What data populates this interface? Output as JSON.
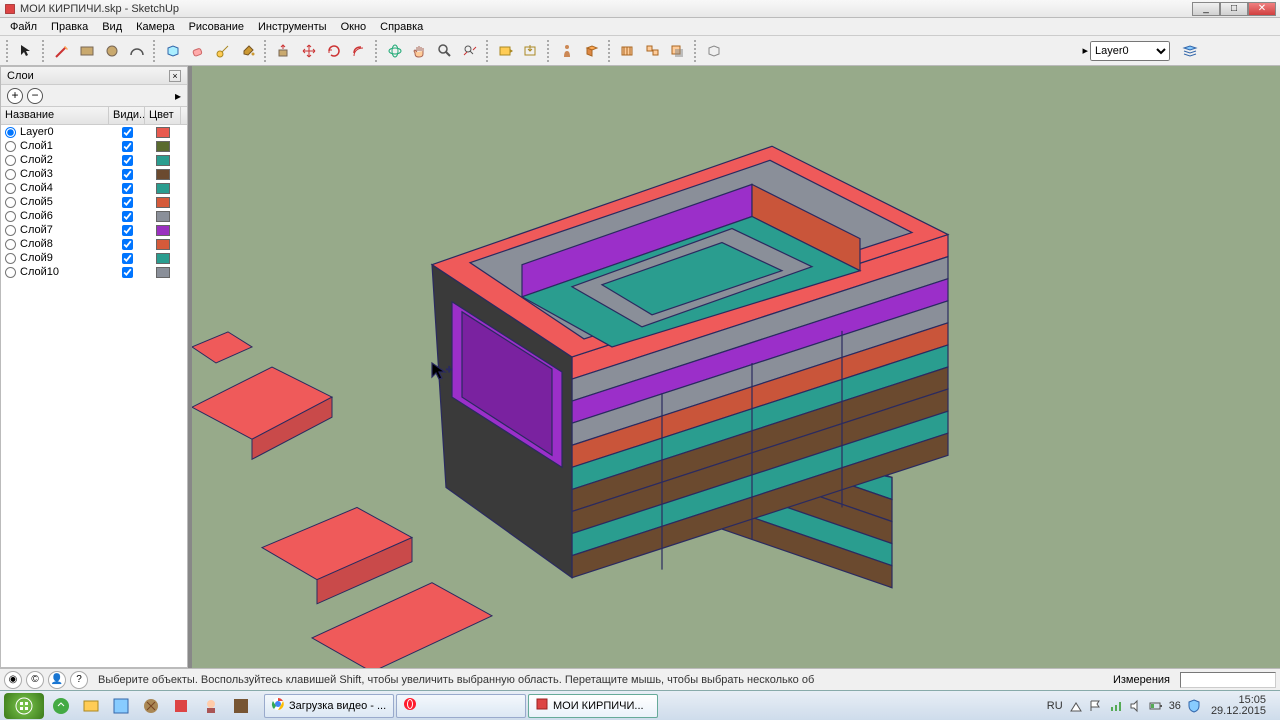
{
  "window": {
    "title": "МОИ КИРПИЧИ.skp - SketchUp"
  },
  "menu": [
    "Файл",
    "Правка",
    "Вид",
    "Камера",
    "Рисование",
    "Инструменты",
    "Окно",
    "Справка"
  ],
  "layer_dropdown": {
    "selected": "Layer0"
  },
  "layers_panel": {
    "title": "Слои",
    "col_name": "Название",
    "col_visible": "Види...",
    "col_color": "Цвет",
    "layers": [
      {
        "name": "Layer0",
        "active": true,
        "visible": true,
        "color": "#e85a4f"
      },
      {
        "name": "Слой1",
        "active": false,
        "visible": true,
        "color": "#5a6b2f"
      },
      {
        "name": "Слой2",
        "active": false,
        "visible": true,
        "color": "#2a9d8f"
      },
      {
        "name": "Слой3",
        "active": false,
        "visible": true,
        "color": "#6b4a2f"
      },
      {
        "name": "Слой4",
        "active": false,
        "visible": true,
        "color": "#2a9d8f"
      },
      {
        "name": "Слой5",
        "active": false,
        "visible": true,
        "color": "#d55a3a"
      },
      {
        "name": "Слой6",
        "active": false,
        "visible": true,
        "color": "#8a8f99"
      },
      {
        "name": "Слой7",
        "active": false,
        "visible": true,
        "color": "#9b30c0"
      },
      {
        "name": "Слой8",
        "active": false,
        "visible": true,
        "color": "#d55a3a"
      },
      {
        "name": "Слой9",
        "active": false,
        "visible": true,
        "color": "#2a9d8f"
      },
      {
        "name": "Слой10",
        "active": false,
        "visible": true,
        "color": "#8a8f99"
      }
    ]
  },
  "status": {
    "hint": "Выберите объекты. Воспользуйтесь клавишей Shift, чтобы увеличить выбранную область. Перетащите мышь, чтобы выбрать несколько об",
    "measurements_label": "Измерения"
  },
  "taskbar": {
    "tasks": [
      {
        "label": "Загрузка видео - ...",
        "icon": "chrome"
      },
      {
        "label": "",
        "icon": "opera"
      },
      {
        "label": "МОИ КИРПИЧИ...",
        "icon": "sketchup"
      }
    ],
    "lang": "RU",
    "battery": "36",
    "time": "15:05",
    "date": "29.12.2015"
  },
  "colors": {
    "ground": "#97aa8a",
    "red": "#ef5a5a",
    "teal": "#2a9d8f",
    "brown": "#6b4a2f",
    "purple": "#9b2fc9",
    "gray": "#8a8f99",
    "orange": "#c9553a"
  }
}
